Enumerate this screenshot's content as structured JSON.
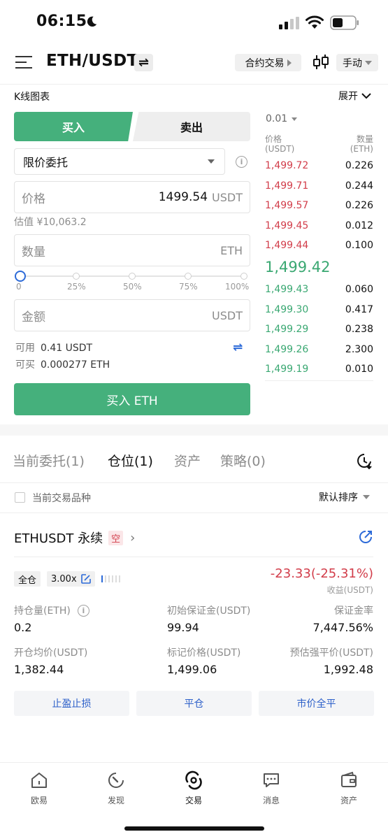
{
  "status_bar": {
    "time": "06:15"
  },
  "header": {
    "pair": "ETH/USDT",
    "contract_label": "合约交易",
    "manual_label": "手动"
  },
  "kline": {
    "label": "K线图表",
    "expand": "展开"
  },
  "trade": {
    "buy_tab": "买入",
    "sell_tab": "卖出",
    "order_type": "限价委托",
    "price_placeholder": "价格",
    "price_value": "1499.54",
    "price_unit": "USDT",
    "estimate": "估值 ¥10,063.2",
    "qty_placeholder": "数量",
    "qty_unit": "ETH",
    "slider_labels": [
      "0",
      "25%",
      "50%",
      "75%",
      "100%"
    ],
    "slider_value_percent": 0,
    "amount_placeholder": "金额",
    "amount_unit": "USDT",
    "available_label": "可用",
    "available_value": "0.41 USDT",
    "can_buy_label": "可买",
    "can_buy_value": "0.000277 ETH",
    "buy_button": "买入 ETH"
  },
  "order_book": {
    "step": "0.01",
    "price_header": [
      "价格",
      "(USDT)"
    ],
    "qty_header": [
      "数量",
      "(ETH)"
    ],
    "asks": [
      {
        "price": "1,499.72",
        "qty": "0.226"
      },
      {
        "price": "1,499.71",
        "qty": "0.244"
      },
      {
        "price": "1,499.57",
        "qty": "0.226"
      },
      {
        "price": "1,499.45",
        "qty": "0.012"
      },
      {
        "price": "1,499.44",
        "qty": "0.100"
      }
    ],
    "mid_price": "1,499.42",
    "bids": [
      {
        "price": "1,499.43",
        "qty": "0.060"
      },
      {
        "price": "1,499.30",
        "qty": "0.417"
      },
      {
        "price": "1,499.29",
        "qty": "0.238"
      },
      {
        "price": "1,499.26",
        "qty": "2.300"
      },
      {
        "price": "1,499.19",
        "qty": "0.010"
      }
    ]
  },
  "tabs": [
    {
      "label": "当前委托(1)",
      "active": false
    },
    {
      "label": "仓位(1)",
      "active": true
    },
    {
      "label": "资产",
      "active": false
    },
    {
      "label": "策略(0)",
      "active": false
    }
  ],
  "filter": {
    "checkbox_label": "当前交易品种",
    "sort_label": "默认排序"
  },
  "position": {
    "name": "ETHUSDT 永续",
    "side": "空",
    "margin_mode": "全仓",
    "leverage": "3.00x",
    "pnl": "-23.33(-25.31%)",
    "pnl_label": "收益(USDT)",
    "stats": [
      {
        "label": "持仓量(ETH)",
        "value": "0.2"
      },
      {
        "label": "初始保证金(USDT)",
        "value": "99.94"
      },
      {
        "label": "保证金率",
        "value": "7,447.56%"
      },
      {
        "label": "开仓均价(USDT)",
        "value": "1,382.44"
      },
      {
        "label": "标记价格(USDT)",
        "value": "1,499.06"
      },
      {
        "label": "预估强平价(USDT)",
        "value": "1,992.48"
      }
    ],
    "actions": [
      "止盈止损",
      "平仓",
      "市价全平"
    ]
  },
  "bottom_nav": [
    {
      "label": "欧易",
      "icon": "home-icon"
    },
    {
      "label": "发现",
      "icon": "discover-icon"
    },
    {
      "label": "交易",
      "icon": "trade-icon"
    },
    {
      "label": "消息",
      "icon": "message-icon"
    },
    {
      "label": "资产",
      "icon": "wallet-icon"
    }
  ],
  "colors": {
    "buy": "#45b07c",
    "sell": "#d23d4a",
    "accent": "#2c6ad8"
  }
}
